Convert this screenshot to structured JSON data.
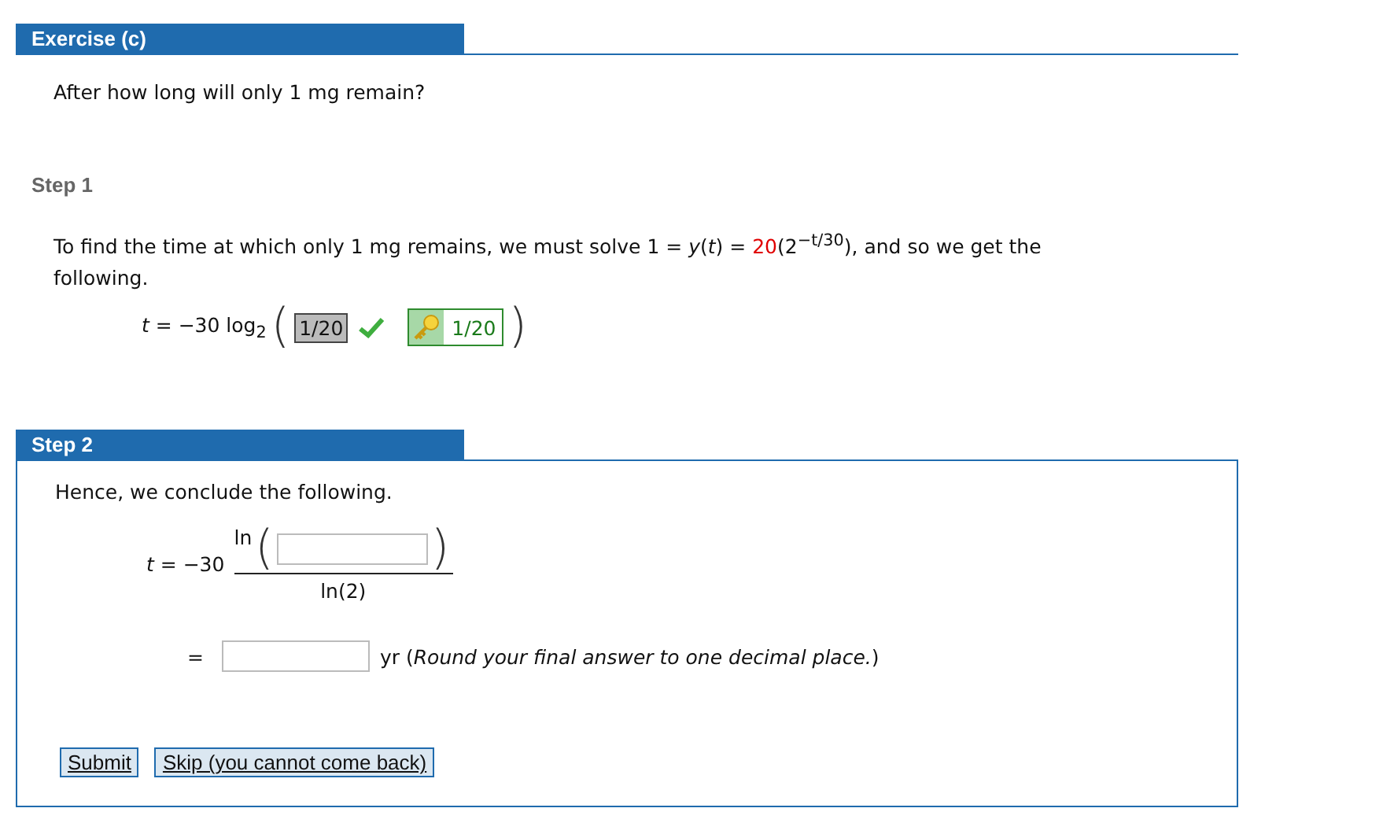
{
  "exercise": {
    "title": "Exercise (c)",
    "question": "After how long will only 1 mg remain?"
  },
  "step1": {
    "label": "Step 1",
    "sentence": [
      {
        "text": "To find the time at which only 1 mg remains, we must solve  1 = *y*(*t*) = "
      },
      {
        "text": "20",
        "color": "#e00000"
      },
      {
        "text": "(2$^{−t/30}$),  and so we get the following."
      }
    ],
    "equation": {
      "lhs": "*t* = −30 log$_{2}$",
      "open": "(",
      "answer": {
        "value": "1/20",
        "correct": true
      },
      "key_answer": "1/20",
      "close": ")"
    }
  },
  "step2": {
    "title": "Step 2",
    "intro": "Hence, we conclude the following.",
    "fraction": {
      "lhs": "*t* = −30",
      "func": "ln",
      "open": "(",
      "close": ")",
      "denominator": "ln(2)"
    },
    "result": {
      "equals": "=",
      "note": "yr (*Round your final answer to one decimal place.*)"
    },
    "buttons": [
      "Submit",
      "Skip (you cannot come back)"
    ]
  }
}
